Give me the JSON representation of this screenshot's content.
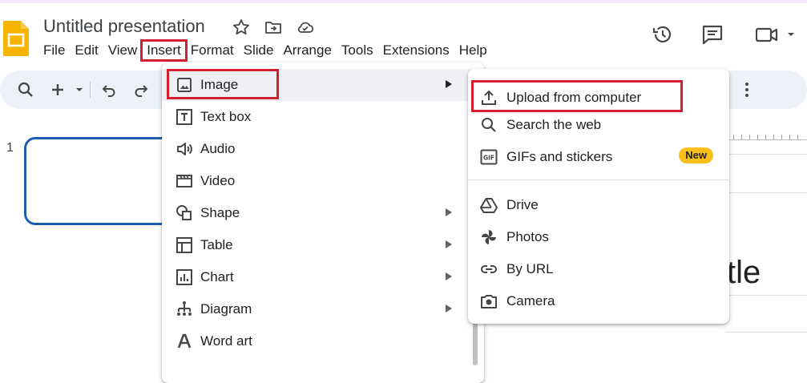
{
  "header": {
    "doc_title": "Untitled presentation",
    "menu": [
      "File",
      "Edit",
      "View",
      "Insert",
      "Format",
      "Slide",
      "Arrange",
      "Tools",
      "Extensions",
      "Help"
    ],
    "active_menu": "Insert"
  },
  "slides": {
    "current_number": "1"
  },
  "canvas": {
    "visible_text": "tle"
  },
  "insert_menu": {
    "items": [
      {
        "label": "Image",
        "icon": "image-icon",
        "submenu": true,
        "highlighted": true
      },
      {
        "label": "Text box",
        "icon": "text-box-icon",
        "submenu": false
      },
      {
        "label": "Audio",
        "icon": "audio-icon",
        "submenu": false
      },
      {
        "label": "Video",
        "icon": "video-icon",
        "submenu": false
      },
      {
        "label": "Shape",
        "icon": "shape-icon",
        "submenu": true
      },
      {
        "label": "Table",
        "icon": "table-icon",
        "submenu": true
      },
      {
        "label": "Chart",
        "icon": "chart-icon",
        "submenu": true
      },
      {
        "label": "Diagram",
        "icon": "diagram-icon",
        "submenu": true
      },
      {
        "label": "Word art",
        "icon": "word-art-icon",
        "submenu": false
      }
    ]
  },
  "image_submenu": {
    "items": [
      {
        "label": "Upload from computer",
        "icon": "upload-icon"
      },
      {
        "label": "Search the web",
        "icon": "search-icon"
      },
      {
        "label": "GIFs and stickers",
        "icon": "gif-icon",
        "badge": "New"
      },
      {
        "label": "Drive",
        "icon": "drive-icon"
      },
      {
        "label": "Photos",
        "icon": "photos-icon"
      },
      {
        "label": "By URL",
        "icon": "link-icon"
      },
      {
        "label": "Camera",
        "icon": "camera-icon"
      }
    ]
  },
  "colors": {
    "highlight_box": "#d3202f",
    "new_badge": "#f9bf1a",
    "slide_selected_border": "#1a5fb4",
    "toolbar_bg": "#edf2fa",
    "logo": "#f4b400"
  }
}
